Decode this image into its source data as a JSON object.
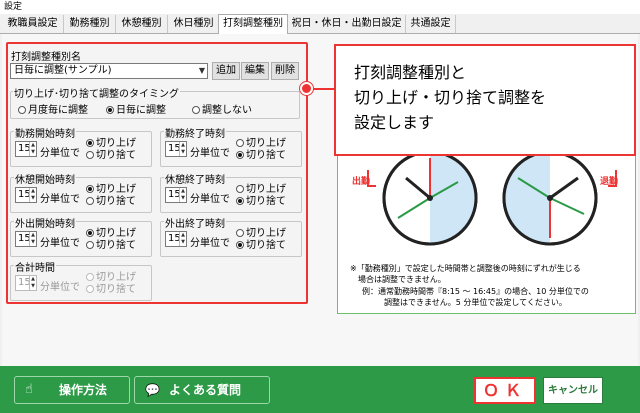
{
  "window": {
    "title": "設定"
  },
  "tabs": [
    {
      "label": "教職員設定",
      "active": false
    },
    {
      "label": "勤務種別",
      "active": false
    },
    {
      "label": "休憩種別",
      "active": false
    },
    {
      "label": "休日種別",
      "active": false
    },
    {
      "label": "打刻調整種別",
      "active": true
    },
    {
      "label": "祝日・休日・出勤日設定",
      "active": false
    },
    {
      "label": "共通設定",
      "active": false
    }
  ],
  "settings": {
    "type_name_label": "打刻調整種別名",
    "type_selected": "日毎に調整(サンプル)",
    "add_label": "追加",
    "edit_label": "編集",
    "delete_label": "削除",
    "timing_title": "切り上げ･切り捨て調整のタイミング",
    "timing_options": [
      "月度毎に調整",
      "日毎に調整",
      "調整しない"
    ],
    "timing_selected_index": 1,
    "unit_text": "分単位で",
    "round_up": "切り上げ",
    "round_down": "切り捨て",
    "groups": [
      {
        "title": "勤務開始時刻",
        "value": "15",
        "selected": "round_up"
      },
      {
        "title": "勤務終了時刻",
        "value": "15",
        "selected": "round_down"
      },
      {
        "title": "休憩開始時刻",
        "value": "15",
        "selected": "round_up"
      },
      {
        "title": "休憩終了時刻",
        "value": "15",
        "selected": "round_down"
      },
      {
        "title": "外出開始時刻",
        "value": "15",
        "selected": "round_up"
      },
      {
        "title": "外出終了時刻",
        "value": "15",
        "selected": "round_down"
      },
      {
        "title": "合計時間",
        "value": "15",
        "selected": "none",
        "disabled": true
      }
    ]
  },
  "callout": {
    "lines": [
      "打刻調整種別と",
      "切り上げ・切り捨て調整を",
      "設定します"
    ]
  },
  "illustration": {
    "label_in": "出勤",
    "label_out": "退勤",
    "note1": "※「勤務種別」で設定した時間帯と調整後の時刻にずれが生じる",
    "note2": "場合は調整できません。",
    "note3": "例：通常勤務時間帯『8:15 ～ 16:45』の場合、10 分単位での",
    "note4": "調整はできません。5 分単位で設定してください。"
  },
  "footer": {
    "howto_label": "操作方法",
    "faq_label": "よくある質問",
    "ok_label": "ＯＫ",
    "cancel_label": "キャンセル"
  },
  "colors": {
    "accent_red": "#e33333",
    "footer_green": "#2c9a46",
    "clock_blue": "#cfe6f7"
  }
}
